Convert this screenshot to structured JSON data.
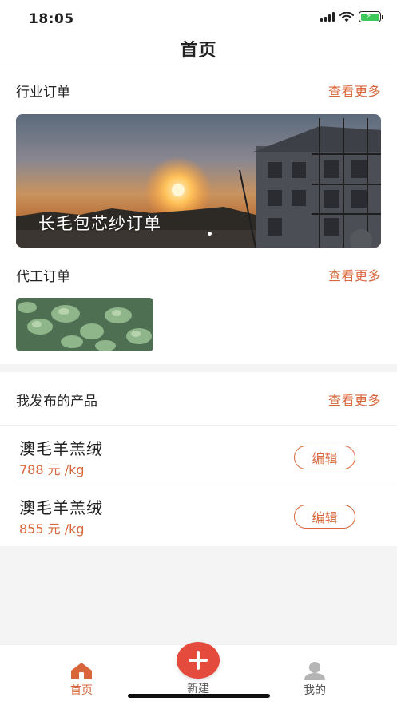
{
  "status_bar": {
    "time": "18:05"
  },
  "nav": {
    "title": "首页"
  },
  "industry_orders": {
    "title": "行业订单",
    "see_more": "查看更多",
    "banner_caption": "长毛包芯纱订单"
  },
  "oem_orders": {
    "title": "代工订单",
    "see_more": "查看更多"
  },
  "my_products": {
    "title": "我发布的产品",
    "see_more": "查看更多",
    "items": [
      {
        "name": "澳毛羊羔绒",
        "price": "788 元 /kg",
        "edit_label": "编辑"
      },
      {
        "name": "澳毛羊羔绒",
        "price": "855 元 /kg",
        "edit_label": "编辑"
      }
    ]
  },
  "tab_bar": {
    "home": "首页",
    "new": "新建",
    "me": "我的"
  },
  "colors": {
    "accent": "#d9663a",
    "plus_button": "#e44b3c",
    "battery": "#3cc85a"
  }
}
